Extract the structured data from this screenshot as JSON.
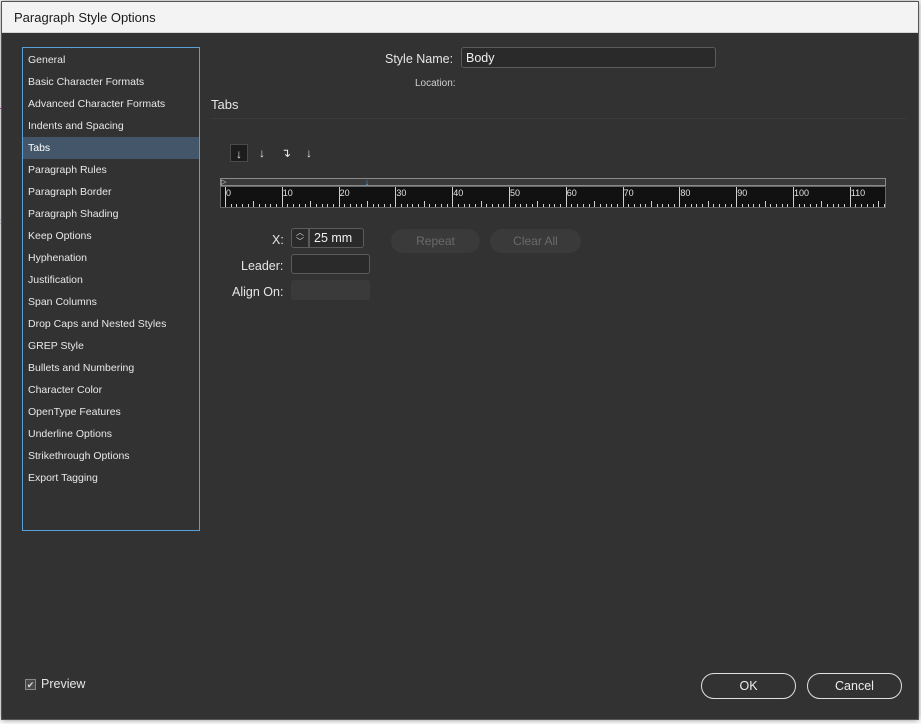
{
  "window": {
    "title": "Paragraph Style Options"
  },
  "sidebar": {
    "items": [
      {
        "label": "General"
      },
      {
        "label": "Basic Character Formats"
      },
      {
        "label": "Advanced Character Formats"
      },
      {
        "label": "Indents and Spacing"
      },
      {
        "label": "Tabs",
        "selected": true
      },
      {
        "label": "Paragraph Rules"
      },
      {
        "label": "Paragraph Border"
      },
      {
        "label": "Paragraph Shading"
      },
      {
        "label": "Keep Options"
      },
      {
        "label": "Hyphenation"
      },
      {
        "label": "Justification"
      },
      {
        "label": "Span Columns"
      },
      {
        "label": "Drop Caps and Nested Styles"
      },
      {
        "label": "GREP Style"
      },
      {
        "label": "Bullets and Numbering"
      },
      {
        "label": "Character Color"
      },
      {
        "label": "OpenType Features"
      },
      {
        "label": "Underline Options"
      },
      {
        "label": "Strikethrough Options"
      },
      {
        "label": "Export Tagging"
      }
    ]
  },
  "style_name": {
    "label": "Style Name:",
    "value": "Body"
  },
  "location": {
    "label": "Location:"
  },
  "section": {
    "title": "Tabs"
  },
  "tab_alignment": {
    "buttons": [
      {
        "icon": "left-justified-tab-icon",
        "glyph": "↓",
        "active": true
      },
      {
        "icon": "center-justified-tab-icon",
        "glyph": "↓"
      },
      {
        "icon": "right-justified-tab-icon",
        "glyph": "↴"
      },
      {
        "icon": "align-to-decimal-tab-icon",
        "glyph": "↓"
      }
    ]
  },
  "ruler": {
    "labels": [
      "0",
      "10",
      "20",
      "30",
      "40",
      "50",
      "60",
      "70",
      "80",
      "90",
      "100",
      "110"
    ],
    "tab_stop_mm": 25
  },
  "fields": {
    "x_label": "X:",
    "x_value": "25 mm",
    "leader_label": "Leader:",
    "leader_value": "",
    "align_on_label": "Align On:",
    "align_on_value": ""
  },
  "buttons": {
    "repeat": "Repeat",
    "clear_all": "Clear All",
    "ok": "OK",
    "cancel": "Cancel"
  },
  "preview": {
    "label": "Preview",
    "checked": true
  },
  "colors": {
    "accent": "#5aa0d8",
    "dialog_bg": "#323232",
    "selected_item": "#44566a"
  }
}
